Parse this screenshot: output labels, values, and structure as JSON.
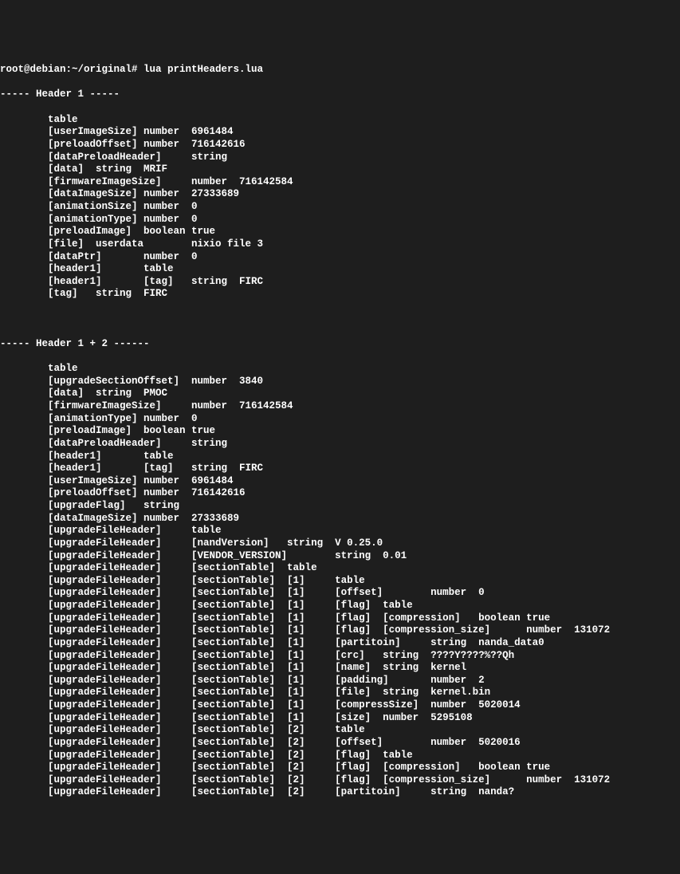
{
  "prompt": "root@debian:~/original# lua printHeaders.lua",
  "header1_title": "----- Header 1 -----",
  "header1": [
    "        table",
    "        [userImageSize] number  6961484",
    "        [preloadOffset] number  716142616",
    "        [dataPreloadHeader]     string",
    "        [data]  string  MRIF",
    "        [firmwareImageSize]     number  716142584",
    "        [dataImageSize] number  27333689",
    "        [animationSize] number  0",
    "        [animationType] number  0",
    "        [preloadImage]  boolean true",
    "        [file]  userdata        nixio file 3",
    "        [dataPtr]       number  0",
    "        [header1]       table",
    "        [header1]       [tag]   string  FIRC",
    "        [tag]   string  FIRC"
  ],
  "header2_title": "----- Header 1 + 2 ------",
  "header2": [
    "        table",
    "        [upgradeSectionOffset]  number  3840",
    "        [data]  string  PMOC",
    "        [firmwareImageSize]     number  716142584",
    "        [animationType] number  0",
    "        [preloadImage]  boolean true",
    "        [dataPreloadHeader]     string",
    "        [header1]       table",
    "        [header1]       [tag]   string  FIRC",
    "        [userImageSize] number  6961484",
    "        [preloadOffset] number  716142616",
    "        [upgradeFlag]   string",
    "        [dataImageSize] number  27333689",
    "        [upgradeFileHeader]     table",
    "        [upgradeFileHeader]     [nandVersion]   string  V 0.25.0",
    "        [upgradeFileHeader]     [VENDOR_VERSION]        string  0.01",
    "        [upgradeFileHeader]     [sectionTable]  table",
    "        [upgradeFileHeader]     [sectionTable]  [1]     table",
    "        [upgradeFileHeader]     [sectionTable]  [1]     [offset]        number  0",
    "        [upgradeFileHeader]     [sectionTable]  [1]     [flag]  table",
    "        [upgradeFileHeader]     [sectionTable]  [1]     [flag]  [compression]   boolean true",
    "        [upgradeFileHeader]     [sectionTable]  [1]     [flag]  [compression_size]      number  131072",
    "        [upgradeFileHeader]     [sectionTable]  [1]     [partitoin]     string  nanda_data0",
    "        [upgradeFileHeader]     [sectionTable]  [1]     [crc]   string  ????Y????%??Qh",
    "        [upgradeFileHeader]     [sectionTable]  [1]     [name]  string  kernel",
    "        [upgradeFileHeader]     [sectionTable]  [1]     [padding]       number  2",
    "        [upgradeFileHeader]     [sectionTable]  [1]     [file]  string  kernel.bin",
    "        [upgradeFileHeader]     [sectionTable]  [1]     [compressSize]  number  5020014",
    "        [upgradeFileHeader]     [sectionTable]  [1]     [size]  number  5295108",
    "        [upgradeFileHeader]     [sectionTable]  [2]     table",
    "        [upgradeFileHeader]     [sectionTable]  [2]     [offset]        number  5020016",
    "        [upgradeFileHeader]     [sectionTable]  [2]     [flag]  table",
    "        [upgradeFileHeader]     [sectionTable]  [2]     [flag]  [compression]   boolean true",
    "        [upgradeFileHeader]     [sectionTable]  [2]     [flag]  [compression_size]      number  131072",
    "        [upgradeFileHeader]     [sectionTable]  [2]     [partitoin]     string  nanda?"
  ]
}
